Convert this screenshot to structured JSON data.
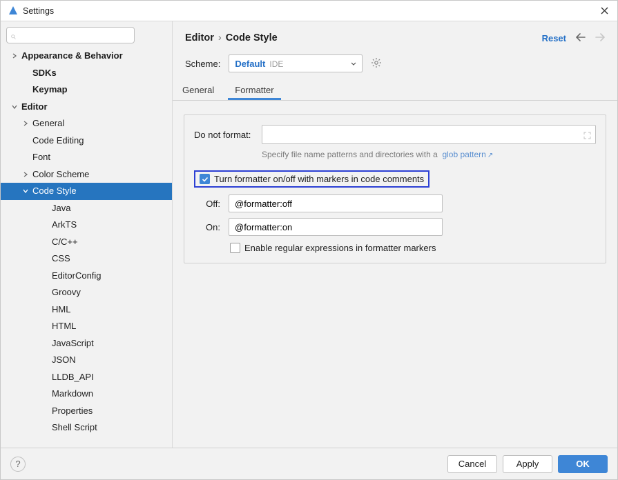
{
  "window": {
    "title": "Settings"
  },
  "sidebar": {
    "search_placeholder": "",
    "items": [
      {
        "label": "Appearance & Behavior",
        "bold": true,
        "arrow": "right",
        "pad": 1
      },
      {
        "label": "SDKs",
        "bold": true,
        "arrow": "",
        "pad": 2
      },
      {
        "label": "Keymap",
        "bold": true,
        "arrow": "",
        "pad": 2
      },
      {
        "label": "Editor",
        "bold": true,
        "arrow": "down",
        "pad": 1
      },
      {
        "label": "General",
        "bold": false,
        "arrow": "right",
        "pad": 2
      },
      {
        "label": "Code Editing",
        "bold": false,
        "arrow": "",
        "pad": 2
      },
      {
        "label": "Font",
        "bold": false,
        "arrow": "",
        "pad": 2
      },
      {
        "label": "Color Scheme",
        "bold": false,
        "arrow": "right",
        "pad": 2
      },
      {
        "label": "Code Style",
        "bold": false,
        "arrow": "down",
        "pad": 2,
        "selected": true
      },
      {
        "label": "Java",
        "bold": false,
        "arrow": "",
        "pad": 3
      },
      {
        "label": "ArkTS",
        "bold": false,
        "arrow": "",
        "pad": 3
      },
      {
        "label": "C/C++",
        "bold": false,
        "arrow": "",
        "pad": 3
      },
      {
        "label": "CSS",
        "bold": false,
        "arrow": "",
        "pad": 3
      },
      {
        "label": "EditorConfig",
        "bold": false,
        "arrow": "",
        "pad": 3
      },
      {
        "label": "Groovy",
        "bold": false,
        "arrow": "",
        "pad": 3
      },
      {
        "label": "HML",
        "bold": false,
        "arrow": "",
        "pad": 3
      },
      {
        "label": "HTML",
        "bold": false,
        "arrow": "",
        "pad": 3
      },
      {
        "label": "JavaScript",
        "bold": false,
        "arrow": "",
        "pad": 3
      },
      {
        "label": "JSON",
        "bold": false,
        "arrow": "",
        "pad": 3
      },
      {
        "label": "LLDB_API",
        "bold": false,
        "arrow": "",
        "pad": 3
      },
      {
        "label": "Markdown",
        "bold": false,
        "arrow": "",
        "pad": 3
      },
      {
        "label": "Properties",
        "bold": false,
        "arrow": "",
        "pad": 3
      },
      {
        "label": "Shell Script",
        "bold": false,
        "arrow": "",
        "pad": 3
      }
    ]
  },
  "header": {
    "crumb1": "Editor",
    "crumb2": "Code Style",
    "reset": "Reset"
  },
  "scheme": {
    "label": "Scheme:",
    "value": "Default",
    "sub": "IDE"
  },
  "tabs": {
    "general": "General",
    "formatter": "Formatter"
  },
  "form": {
    "donotformat_label": "Do not format:",
    "hint_prefix": "Specify file name patterns and directories with a",
    "hint_link": "glob pattern",
    "markers_label": "Turn formatter on/off with markers in code comments",
    "off_label": "Off:",
    "off_value": "@formatter:off",
    "on_label": "On:",
    "on_value": "@formatter:on",
    "regex_label": "Enable regular expressions in formatter markers"
  },
  "footer": {
    "cancel": "Cancel",
    "apply": "Apply",
    "ok": "OK"
  }
}
